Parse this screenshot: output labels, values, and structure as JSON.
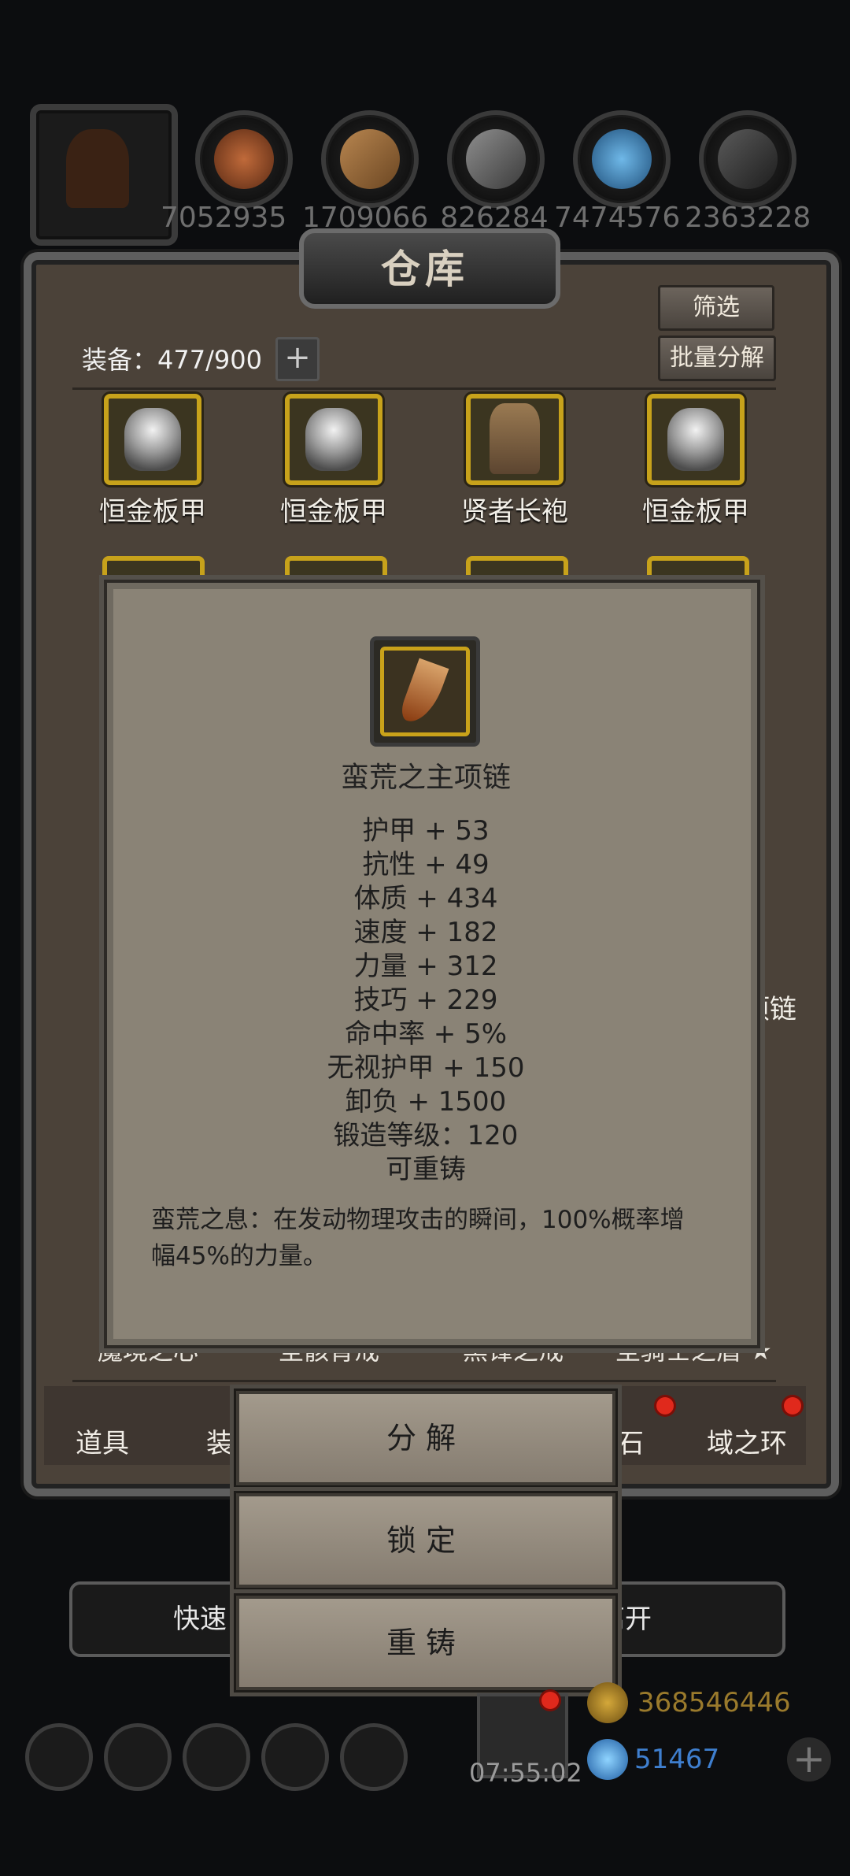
{
  "resources": {
    "counts": [
      "7052935",
      "1709066",
      "826284",
      "7474576",
      "2363228"
    ]
  },
  "panel": {
    "title": "仓库",
    "filter_label": "筛选",
    "batch_label": "批量分解",
    "equip_count_label": "装备：477/900",
    "plus_label": "+"
  },
  "items": [
    {
      "name": "恒金板甲"
    },
    {
      "name": "恒金板甲"
    },
    {
      "name": "贤者长袍"
    },
    {
      "name": "恒金板甲"
    }
  ],
  "partial_names": {
    "right_mid": "项链",
    "bottom_row": [
      "魔境之心",
      "圣骸背戒",
      "黑锋之戒",
      "圣骑士之盾 ★"
    ]
  },
  "tabs": {
    "props": "道具",
    "equip": "装",
    "gem": "宝石",
    "ring": "域之环"
  },
  "tooltip": {
    "title": "蛮荒之主项链",
    "stats": [
      "护甲 + 53",
      "抗性 + 49",
      "体质 + 434",
      "速度 + 182",
      "力量 + 312",
      "技巧 + 229",
      "命中率 + 5%",
      "无视护甲 + 150",
      "卸负 + 1500",
      "锻造等级：120",
      "可重铸"
    ],
    "description": "蛮荒之息：在发动物理攻击的瞬间，100%概率增幅45%的力量。"
  },
  "actions": {
    "decompose": "分解",
    "lock": "锁定",
    "recast": "重铸"
  },
  "quick": {
    "left": "快速",
    "right": "离开"
  },
  "footer": {
    "timer": "07:55:02",
    "gold": "368546446",
    "diamond": "51467",
    "add": "+"
  },
  "colors": {
    "gold_text": "#9a7a2c",
    "diamond_text": "#3f7fcf",
    "red_dot": "#e0291c"
  },
  "icons": [
    "hero-portrait-icon",
    "meat-icon",
    "wood-icon",
    "iron-icon",
    "crystal-icon",
    "coal-icon",
    "armor-icon",
    "robe-icon",
    "necklace-tooth-icon",
    "gift-icon",
    "gold-coin-icon",
    "diamond-icon"
  ]
}
